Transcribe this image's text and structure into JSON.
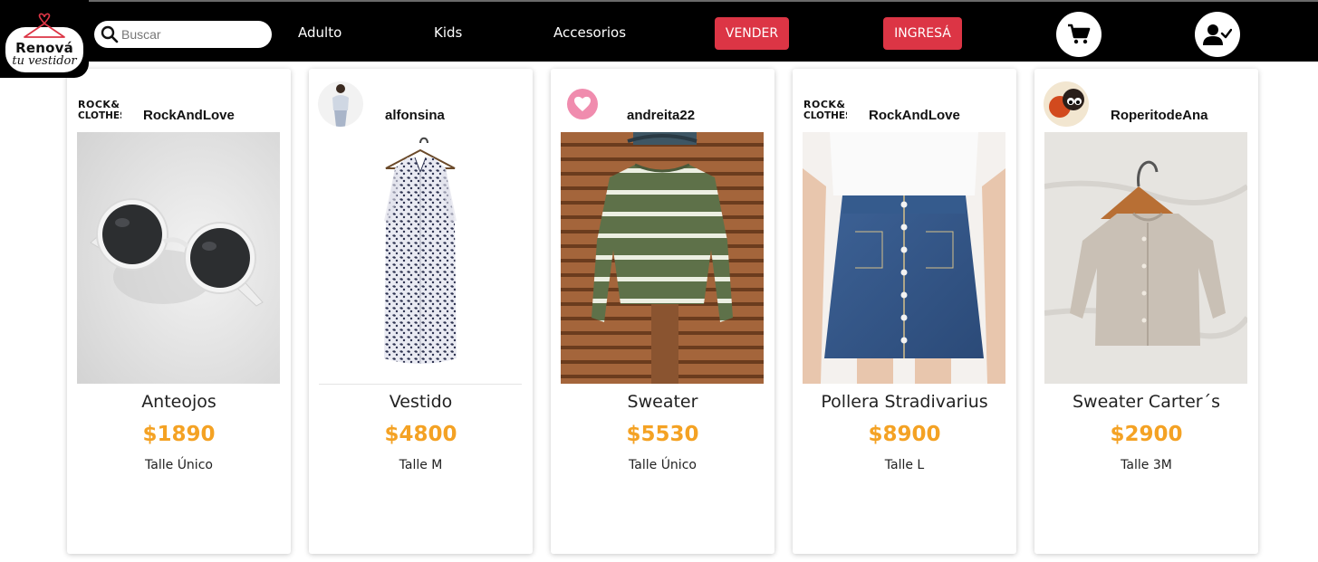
{
  "brand": {
    "line1": "Renová",
    "line2": "tu vestidor",
    "accent": "#dc3545"
  },
  "search": {
    "placeholder": "Buscar",
    "value": ""
  },
  "nav": {
    "adulto": "Adulto",
    "kids": "Kids",
    "accesorios": "Accesorios"
  },
  "buttons": {
    "vender": "VENDER",
    "ingresa": "INGRESÁ"
  },
  "icons": {
    "cart": "cart-icon",
    "user": "user-check-icon"
  },
  "products": [
    {
      "seller": "RockAndLove",
      "seller_logo": "ROCK& CLOTHES",
      "name": "Anteojos",
      "price": "$1890",
      "size": "Talle Único"
    },
    {
      "seller": "alfonsina",
      "name": "Vestido",
      "price": "$4800",
      "size": "Talle M"
    },
    {
      "seller": "andreita22",
      "name": "Sweater",
      "price": "$5530",
      "size": "Talle Único"
    },
    {
      "seller": "RockAndLove",
      "seller_logo": "ROCK& CLOTHES",
      "name": "Pollera Stradivarius",
      "price": "$8900",
      "size": "Talle L"
    },
    {
      "seller": "RoperitodeAna",
      "name": "Sweater Carter´s",
      "price": "$2900",
      "size": "Talle 3M"
    }
  ],
  "colors": {
    "price": "#f4a224",
    "header": "#000000"
  }
}
